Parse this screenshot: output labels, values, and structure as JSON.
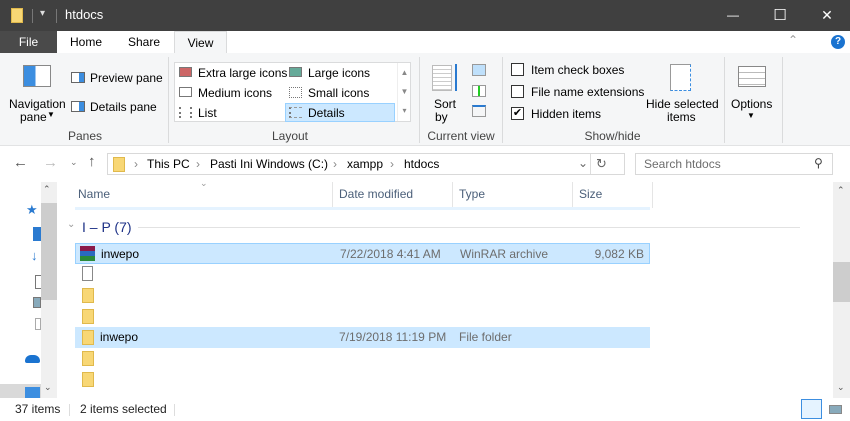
{
  "window": {
    "title": "htdocs",
    "minimize": "—",
    "maximize": "☐",
    "close": "✕"
  },
  "ribbon_tabs": [
    "File",
    "Home",
    "Share",
    "View"
  ],
  "ribbon": {
    "panes": {
      "navigation_pane": "Navigation",
      "navigation_pane2": "pane",
      "preview_pane": "Preview pane",
      "details_pane": "Details pane",
      "label": "Panes"
    },
    "layout": {
      "items": [
        "Extra large icons",
        "Large icons",
        "Medium icons",
        "Small icons",
        "List",
        "Details"
      ],
      "selected": "Details",
      "label": "Layout"
    },
    "current_view": {
      "sort_by": "Sort",
      "sort_by2": "by",
      "label": "Current view"
    },
    "show_hide": {
      "item_check_boxes": "Item check boxes",
      "file_name_extensions": "File name extensions",
      "hidden_items": "Hidden items",
      "hidden_items_checked": true,
      "hide_selected": "Hide selected",
      "hide_selected2": "items",
      "label": "Show/hide"
    },
    "options": {
      "label": "Options"
    }
  },
  "address": {
    "crumbs": [
      "This PC",
      "Pasti Ini Windows (C:)",
      "xampp",
      "htdocs"
    ],
    "search_placeholder": "Search htdocs"
  },
  "columns": [
    "Name",
    "Date modified",
    "Type",
    "Size"
  ],
  "group": {
    "label": "I – P (7)"
  },
  "rows": [
    {
      "name": "inwepo",
      "date": "7/22/2018 4:41 AM",
      "type": "WinRAR archive",
      "size": "9,082 KB",
      "icon": "winrar-archive-icon",
      "selected": true
    },
    {
      "name": "",
      "date": "",
      "type": "",
      "size": "",
      "icon": "file-icon",
      "selected": false
    },
    {
      "name": "",
      "date": "",
      "type": "",
      "size": "",
      "icon": "folder-icon",
      "selected": false
    },
    {
      "name": "",
      "date": "",
      "type": "",
      "size": "",
      "icon": "folder-icon",
      "selected": false
    },
    {
      "name": "inwepo",
      "date": "7/19/2018 11:19 PM",
      "type": "File folder",
      "size": "",
      "icon": "folder-icon",
      "selected": true
    },
    {
      "name": "",
      "date": "",
      "type": "",
      "size": "",
      "icon": "folder-icon",
      "selected": false
    },
    {
      "name": "",
      "date": "",
      "type": "",
      "size": "",
      "icon": "folder-icon",
      "selected": false
    }
  ],
  "status": {
    "item_count": "37 items",
    "selected_count": "2 items selected"
  }
}
